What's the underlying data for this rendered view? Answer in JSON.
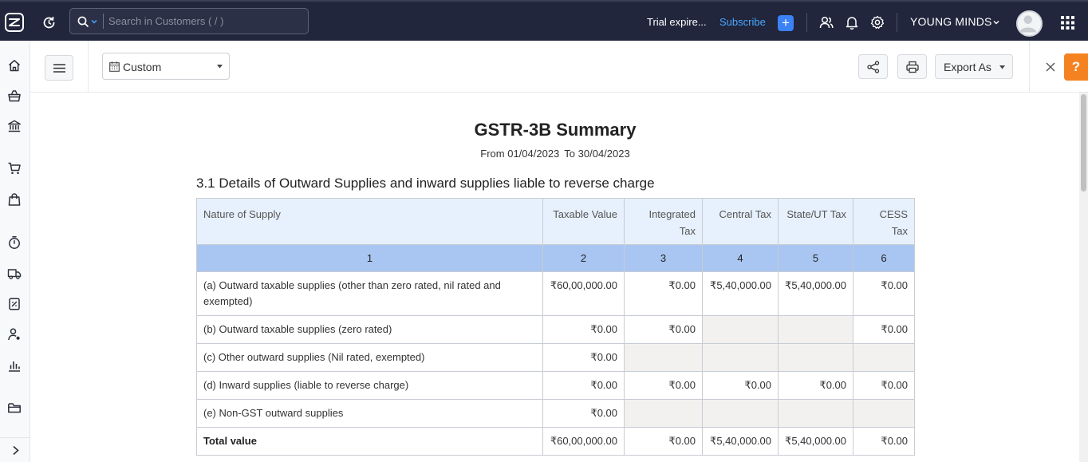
{
  "topbar": {
    "search_placeholder": "Search in Customers ( / )",
    "trial_text": "Trial expire...",
    "subscribe_label": "Subscribe",
    "add_label": "+",
    "org_name": "YOUNG MINDS"
  },
  "sidebar": {
    "items": [
      {
        "icon": "home-icon"
      },
      {
        "icon": "shopping-basket-icon"
      },
      {
        "icon": "bank-icon"
      },
      {
        "icon": "cart-icon"
      },
      {
        "icon": "shopping-bag-icon"
      },
      {
        "icon": "timer-icon"
      },
      {
        "icon": "truck-icon"
      },
      {
        "icon": "document-icon"
      },
      {
        "icon": "accountant-icon"
      },
      {
        "icon": "reports-icon"
      },
      {
        "icon": "folder-icon"
      }
    ]
  },
  "toolbar": {
    "date_filter": "Custom",
    "export_label": "Export As",
    "help_label": "?"
  },
  "report": {
    "title": "GSTR-3B Summary",
    "from_text": "From 01/04/2023",
    "to_text": "To 30/04/2023",
    "section_title": "3.1 Details of Outward Supplies and inward supplies liable to reverse charge",
    "headers": {
      "nature": "Nature of Supply",
      "taxable": "Taxable Value",
      "integrated_1": "Integrated",
      "integrated_2": "Tax",
      "central": "Central Tax",
      "state": "State/UT Tax",
      "cess_1": "CESS",
      "cess_2": "Tax"
    },
    "col_numbers": [
      "1",
      "2",
      "3",
      "4",
      "5",
      "6"
    ],
    "rows": [
      {
        "nature": "(a) Outward taxable supplies (other than zero rated, nil rated and exempted)",
        "taxable": "₹60,00,000.00",
        "integrated": "₹0.00",
        "central": "₹5,40,000.00",
        "state": "₹5,40,000.00",
        "cess": "₹0.00"
      },
      {
        "nature": "(b) Outward taxable supplies (zero rated)",
        "taxable": "₹0.00",
        "integrated": "₹0.00",
        "central": "",
        "state": "",
        "cess": "₹0.00"
      },
      {
        "nature": "(c) Other outward supplies (Nil rated, exempted)",
        "taxable": "₹0.00",
        "integrated": "",
        "central": "",
        "state": "",
        "cess": ""
      },
      {
        "nature": "(d) Inward supplies (liable to reverse charge)",
        "taxable": "₹0.00",
        "integrated": "₹0.00",
        "central": "₹0.00",
        "state": "₹0.00",
        "cess": "₹0.00"
      },
      {
        "nature": "(e) Non-GST outward supplies",
        "taxable": "₹0.00",
        "integrated": "",
        "central": "",
        "state": "",
        "cess": ""
      }
    ],
    "total": {
      "label": "Total value",
      "taxable": "₹60,00,000.00",
      "integrated": "₹0.00",
      "central": "₹5,40,000.00",
      "state": "₹5,40,000.00",
      "cess": "₹0.00"
    }
  }
}
